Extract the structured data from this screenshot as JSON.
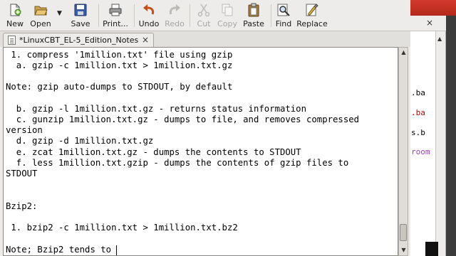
{
  "toolbar": {
    "new": "New",
    "open": "Open",
    "save": "Save",
    "print": "Print...",
    "undo": "Undo",
    "redo": "Redo",
    "cut": "Cut",
    "copy": "Copy",
    "paste": "Paste",
    "find": "Find",
    "replace": "Replace"
  },
  "tab": {
    "label": "*LinuxCBT_EL-5_Edition_Notes",
    "close": "×"
  },
  "editor": {
    "lines": [
      " 1. compress '1million.txt' file using gzip",
      "  a. gzip -c 1million.txt > 1million.txt.gz",
      "",
      "Note: gzip auto-dumps to STDOUT, by default",
      "",
      "  b. gzip -l 1million.txt.gz - returns status information",
      "  c. gunzip 1million.txt.gz - dumps to file, and removes compressed",
      "version",
      "  d. gzip -d 1million.txt.gz",
      "  e. zcat 1million.txt.gz - dumps the contents to STDOUT",
      "  f. less 1million.txt.gzip - dumps the contents of gzip files to",
      "STDOUT",
      "",
      "",
      "Bzip2:",
      "",
      " 1. bzip2 -c 1million.txt > 1million.txt.bz2",
      "",
      "Note; Bzip2 tends to "
    ]
  },
  "background_window": {
    "close": "×",
    "fragments": [
      ".ba",
      ".ba",
      "s.b",
      "room"
    ]
  },
  "colors": {
    "fragment_black": "#000000",
    "fragment_red": "#c00000",
    "fragment_magenta": "#a040c0",
    "titlebar_red": "#c6302a"
  },
  "icons": {
    "new": "new-document-icon",
    "open": "open-folder-icon",
    "save": "save-disk-icon",
    "print": "printer-icon",
    "undo": "undo-arrow-icon",
    "redo": "redo-arrow-icon",
    "cut": "scissors-icon",
    "copy": "copy-icon",
    "paste": "clipboard-icon",
    "find": "magnifier-icon",
    "replace": "find-replace-icon"
  }
}
